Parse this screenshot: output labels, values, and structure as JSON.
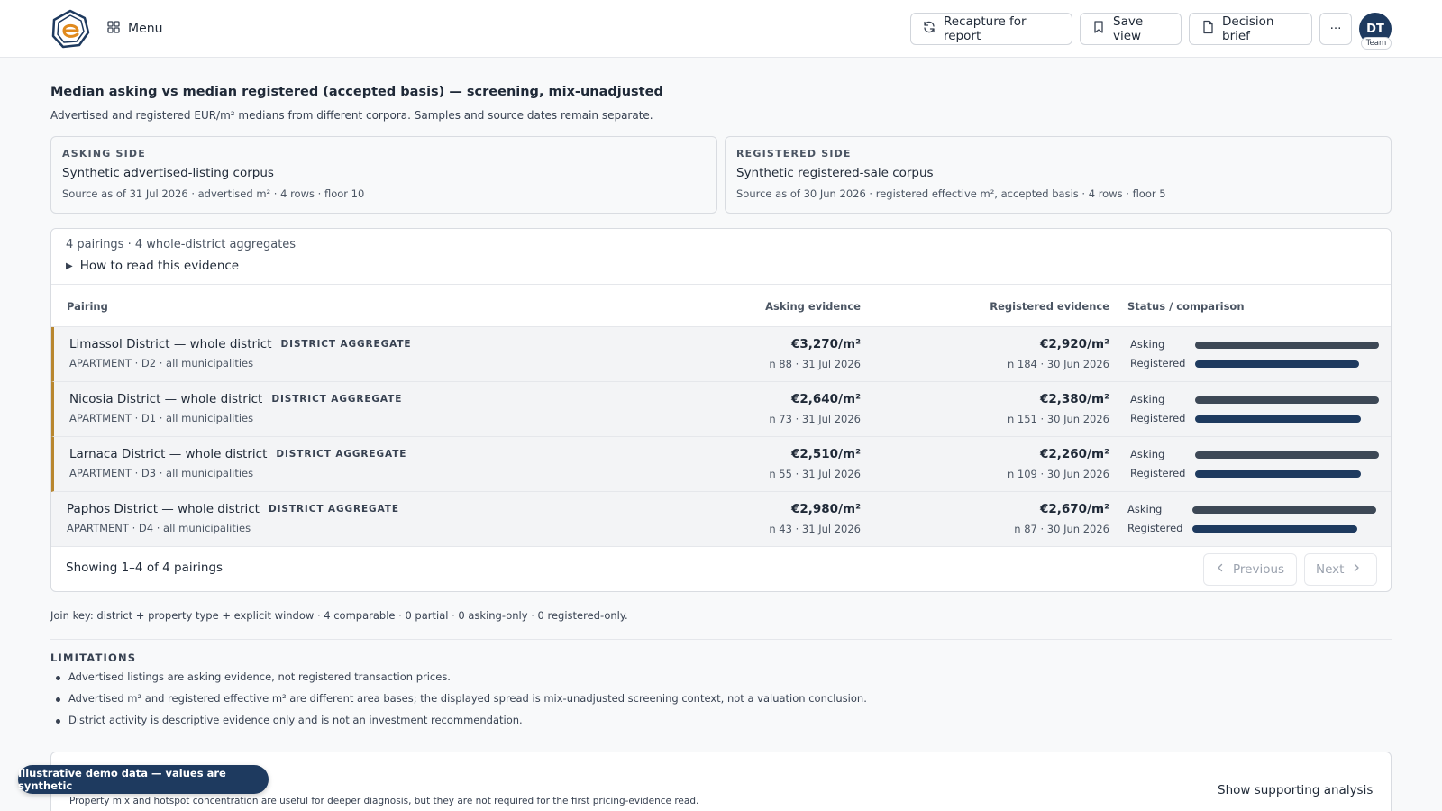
{
  "header": {
    "menu_label": "Menu",
    "actions": {
      "recapture": "Recapture for report",
      "save_view": "Save view",
      "decision_brief": "Decision brief",
      "more": "···"
    },
    "avatar": {
      "initials": "DT",
      "badge": "Team"
    }
  },
  "section": {
    "title": "Median asking vs median registered (accepted basis) — screening, mix-unadjusted",
    "subtitle": "Advertised and registered EUR/m² medians from different corpora. Samples and source dates remain separate."
  },
  "sources": {
    "asking": {
      "kicker": "ASKING SIDE",
      "name": "Synthetic advertised-listing corpus",
      "meta": "Source as of 31 Jul 2026 · advertised m² · 4 rows · floor 10"
    },
    "registered": {
      "kicker": "REGISTERED SIDE",
      "name": "Synthetic registered-sale corpus",
      "meta": "Source as of 30 Jun 2026 · registered effective m², accepted basis · 4 rows · floor 5"
    }
  },
  "table": {
    "summary": "4 pairings · 4 whole-district aggregates",
    "how_to_read": "How to read this evidence",
    "columns": {
      "pairing": "Pairing",
      "asking": "Asking evidence",
      "registered": "Registered evidence",
      "status": "Status / comparison"
    },
    "bar_labels": {
      "asking": "Asking",
      "registered": "Registered"
    },
    "rows": [
      {
        "name": "Limassol District — whole district",
        "tag": "DISTRICT AGGREGATE",
        "sub": "APARTMENT · D2 · all municipalities",
        "ask_value": "€3,270/m²",
        "ask_meta": "n 88 · 31 Jul 2026",
        "reg_value": "€2,920/m²",
        "reg_meta": "n 184 · 30 Jun 2026",
        "ask_ratio": 1.0,
        "reg_ratio": 0.893
      },
      {
        "name": "Nicosia District — whole district",
        "tag": "DISTRICT AGGREGATE",
        "sub": "APARTMENT · D1 · all municipalities",
        "ask_value": "€2,640/m²",
        "ask_meta": "n 73 · 31 Jul 2026",
        "reg_value": "€2,380/m²",
        "reg_meta": "n 151 · 30 Jun 2026",
        "ask_ratio": 1.0,
        "reg_ratio": 0.902
      },
      {
        "name": "Larnaca District — whole district",
        "tag": "DISTRICT AGGREGATE",
        "sub": "APARTMENT · D3 · all municipalities",
        "ask_value": "€2,510/m²",
        "ask_meta": "n 55 · 31 Jul 2026",
        "reg_value": "€2,260/m²",
        "reg_meta": "n 109 · 30 Jun 2026",
        "ask_ratio": 1.0,
        "reg_ratio": 0.9
      },
      {
        "name": "Paphos District — whole district",
        "tag": "DISTRICT AGGREGATE",
        "sub": "APARTMENT · D4 · all municipalities",
        "ask_value": "€2,980/m²",
        "ask_meta": "n 43 · 31 Jul 2026",
        "reg_value": "€2,670/m²",
        "reg_meta": "n 87 · 30 Jun 2026",
        "ask_ratio": 1.0,
        "reg_ratio": 0.896
      }
    ],
    "footer": {
      "showing": "Showing 1–4 of 4 pairings",
      "previous": "Previous",
      "next": "Next"
    }
  },
  "join_key": "Join key: district + property type + explicit window · 4 comparable · 0 partial · 0 asking-only · 0 registered-only.",
  "limitations": {
    "title": "LIMITATIONS",
    "items": [
      "Advertised listings are asking evidence, not registered transaction prices.",
      "Advertised m² and registered effective m² are different area bases; the displayed spread is mix-unadjusted screening context, not a valuation conclusion.",
      "District activity is descriptive evidence only and is not an investment recommendation."
    ]
  },
  "supporting": {
    "text": "Property mix and hotspot concentration are useful for deeper diagnosis, but they are not required for the first pricing-evidence read.",
    "button": "Show supporting analysis"
  },
  "demo_badge": "Illustrative demo data — values are synthetic",
  "colors": {
    "primary": "#1e3a5f",
    "asking_bar": "#3d4856",
    "flag_border": "#b8862f"
  }
}
